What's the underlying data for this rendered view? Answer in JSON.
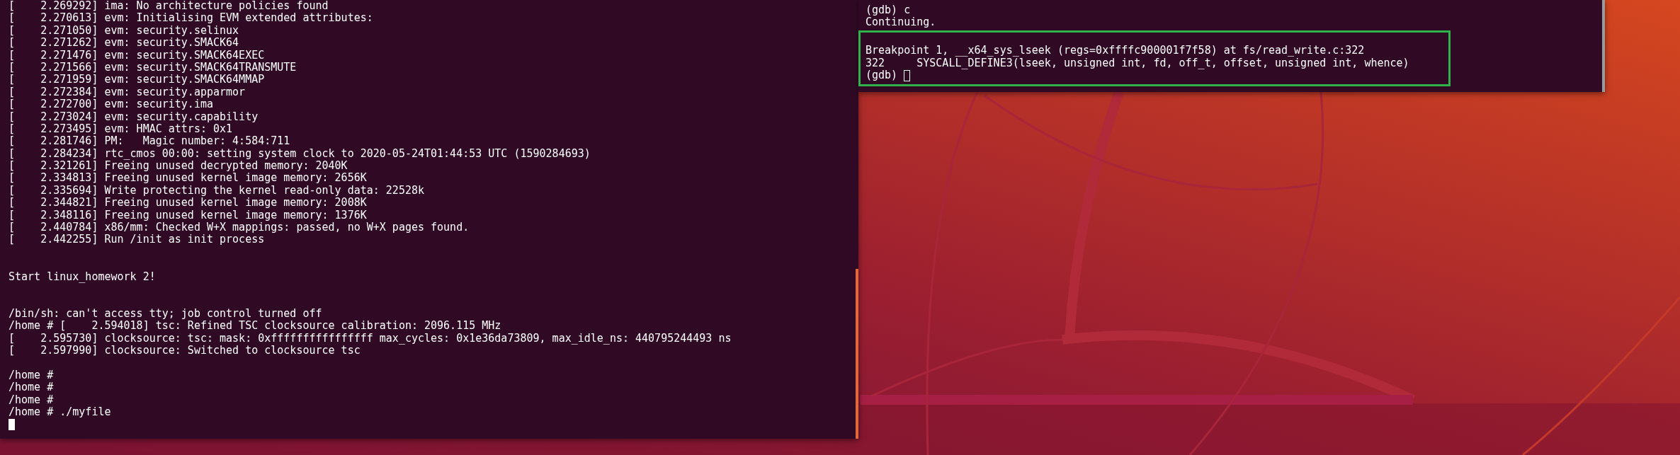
{
  "left_terminal": {
    "focused": true,
    "lines": [
      {
        "kind": "text",
        "text": "[    2.269292] ima: No architecture policies found"
      },
      {
        "kind": "text",
        "text": "[    2.270613] evm: Initialising EVM extended attributes:"
      },
      {
        "kind": "text",
        "text": "[    2.271050] evm: security.selinux"
      },
      {
        "kind": "text",
        "text": "[    2.271262] evm: security.SMACK64"
      },
      {
        "kind": "text",
        "text": "[    2.271476] evm: security.SMACK64EXEC"
      },
      {
        "kind": "text",
        "text": "[    2.271566] evm: security.SMACK64TRANSMUTE"
      },
      {
        "kind": "text",
        "text": "[    2.271959] evm: security.SMACK64MMAP"
      },
      {
        "kind": "text",
        "text": "[    2.272384] evm: security.apparmor"
      },
      {
        "kind": "text",
        "text": "[    2.272700] evm: security.ima"
      },
      {
        "kind": "text",
        "text": "[    2.273024] evm: security.capability"
      },
      {
        "kind": "text",
        "text": "[    2.273495] evm: HMAC attrs: 0x1"
      },
      {
        "kind": "text",
        "text": "[    2.281746] PM:   Magic number: 4:584:711"
      },
      {
        "kind": "text",
        "text": "[    2.284234] rtc_cmos 00:00: setting system clock to 2020-05-24T01:44:53 UTC (1590284693)"
      },
      {
        "kind": "text",
        "text": "[    2.321261] Freeing unused decrypted memory: 2040K"
      },
      {
        "kind": "text",
        "text": "[    2.334813] Freeing unused kernel image memory: 2656K"
      },
      {
        "kind": "text",
        "text": "[    2.335694] Write protecting the kernel read-only data: 22528k"
      },
      {
        "kind": "text",
        "text": "[    2.344821] Freeing unused kernel image memory: 2008K"
      },
      {
        "kind": "text",
        "text": "[    2.348116] Freeing unused kernel image memory: 1376K"
      },
      {
        "kind": "text",
        "text": "[    2.440784] x86/mm: Checked W+X mappings: passed, no W+X pages found."
      },
      {
        "kind": "text",
        "text": "[    2.442255] Run /init as init process"
      },
      {
        "kind": "blank"
      },
      {
        "kind": "blank"
      },
      {
        "kind": "text",
        "text": "Start linux_homework 2!"
      },
      {
        "kind": "blank"
      },
      {
        "kind": "blank"
      },
      {
        "kind": "text",
        "text": "/bin/sh: can't access tty; job control turned off"
      },
      {
        "kind": "text",
        "text": "/home # [    2.594018] tsc: Refined TSC clocksource calibration: 2096.115 MHz"
      },
      {
        "kind": "text",
        "text": "[    2.595730] clocksource: tsc: mask: 0xffffffffffffffff max_cycles: 0x1e36da73809, max_idle_ns: 440795244493 ns"
      },
      {
        "kind": "text",
        "text": "[    2.597990] clocksource: Switched to clocksource tsc"
      },
      {
        "kind": "blank"
      },
      {
        "kind": "text",
        "text": "/home #"
      },
      {
        "kind": "text",
        "text": "/home #"
      },
      {
        "kind": "text",
        "text": "/home #"
      },
      {
        "kind": "text",
        "text": "/home # ./myfile"
      },
      {
        "kind": "prompt"
      }
    ]
  },
  "right_terminal": {
    "focused": false,
    "lines": [
      {
        "kind": "text",
        "text": "(gdb) c"
      },
      {
        "kind": "text",
        "text": "Continuing."
      }
    ],
    "highlighted_lines": [
      {
        "kind": "blank"
      },
      {
        "kind": "text",
        "text": "Breakpoint 1, __x64_sys_lseek (regs=0xffffc900001f7f58) at fs/read_write.c:322"
      },
      {
        "kind": "text",
        "text": "322\tSYSCALL_DEFINE3(lseek, unsigned int, fd, off_t, offset, unsigned int, whence)"
      },
      {
        "kind": "prompt",
        "text": "(gdb) "
      }
    ]
  }
}
